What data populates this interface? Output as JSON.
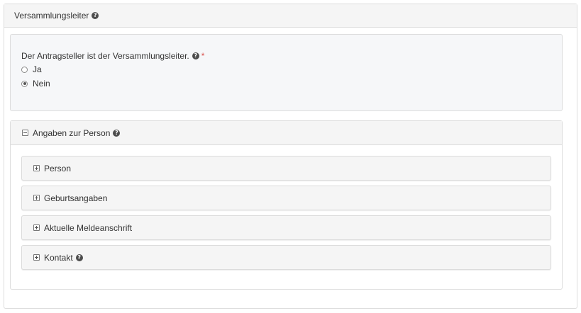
{
  "section": {
    "title": "Versammlungsleiter",
    "help_icon": "question-circle-icon"
  },
  "question": {
    "label": "Der Antragsteller ist der Versammlungsleiter.",
    "required_mark": "*",
    "options": [
      {
        "label": "Ja",
        "selected": false
      },
      {
        "label": "Nein",
        "selected": true
      }
    ]
  },
  "person_panel": {
    "title": "Angaben zur Person",
    "expanded": true,
    "subsections": [
      {
        "label": "Person",
        "has_help": false
      },
      {
        "label": "Geburtsangaben",
        "has_help": false
      },
      {
        "label": "Aktuelle Meldeanschrift",
        "has_help": false
      },
      {
        "label": "Kontakt",
        "has_help": true
      }
    ]
  },
  "colors": {
    "header_bg": "#f5f5f5",
    "question_bg": "#f6f7f9",
    "border": "#dcdcdc",
    "required": "#d9534f"
  }
}
